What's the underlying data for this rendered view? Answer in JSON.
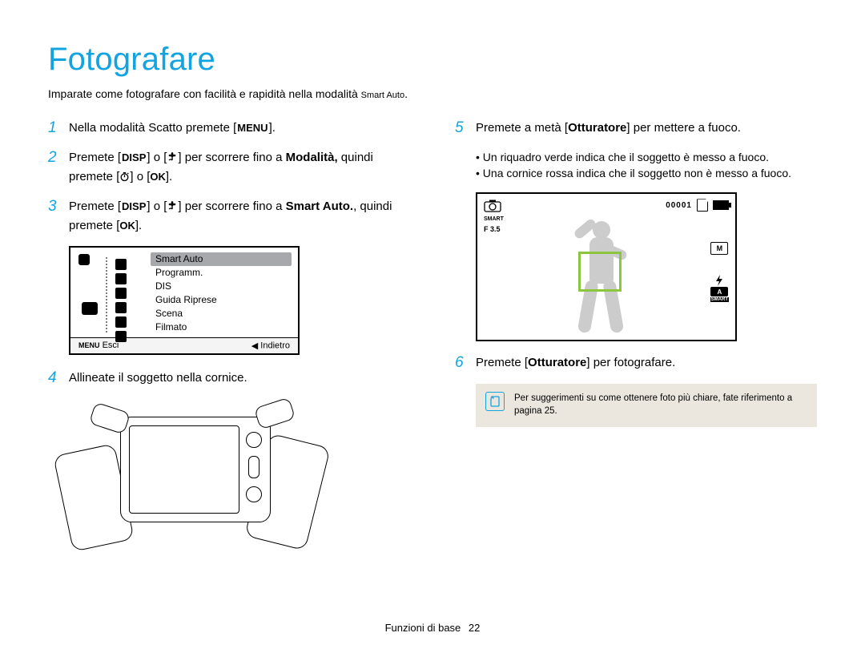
{
  "title": "Fotografare",
  "intro_a": "Imparate come fotografare con facilità e rapidità nella modalità ",
  "intro_small": "Smart Auto",
  "intro_dot": ".",
  "steps": {
    "s1": {
      "num": "1",
      "a": "Nella modalità Scatto premete [",
      "key": "MENU",
      "b": "]."
    },
    "s2": {
      "num": "2",
      "a": "Premete [",
      "key1": "DISP",
      "b": "] o [",
      "c": "] per scorrere fino a ",
      "bold": "Modalità,",
      "d": " quindi premete [",
      "e": "] o [",
      "key2": "OK",
      "f": "]."
    },
    "s3": {
      "num": "3",
      "a": "Premete [",
      "key1": "DISP",
      "b": "] o [",
      "c": "] per scorrere fino a ",
      "bold": "Smart Auto.",
      "d": ", quindi premete [",
      "key2": "OK",
      "e": "]."
    },
    "s4": {
      "num": "4",
      "text": "Allineate il soggetto nella cornice."
    },
    "s5": {
      "num": "5",
      "a": "Premete a metà [",
      "bold": "Otturatore",
      "b": "] per mettere a fuoco."
    },
    "s5_bullets": [
      "Un riquadro verde indica che il soggetto è messo a fuoco.",
      "Una cornice rossa indica che il soggetto non è messo a fuoco."
    ],
    "s6": {
      "num": "6",
      "a": "Premete [",
      "bold": "Otturatore",
      "b": "] per fotografare."
    }
  },
  "menu": {
    "items": [
      "Smart Auto",
      "Programm.",
      "DIS",
      "Guida Riprese",
      "Scena",
      "Filmato"
    ],
    "selected_index": 0,
    "bar_left_label": "Esci",
    "bar_left_key": "MENU",
    "bar_right_label": "Indietro",
    "bar_right_glyph": "◀"
  },
  "preview": {
    "counter": "00001",
    "fnumber": "F 3.5",
    "res_badge": "M",
    "flash_label": "A",
    "mode_label": "SMART"
  },
  "note": {
    "text": "Per suggerimenti su come ottenere foto più chiare, fate riferimento a pagina 25."
  },
  "footer": {
    "section": "Funzioni di base",
    "page": "22"
  }
}
